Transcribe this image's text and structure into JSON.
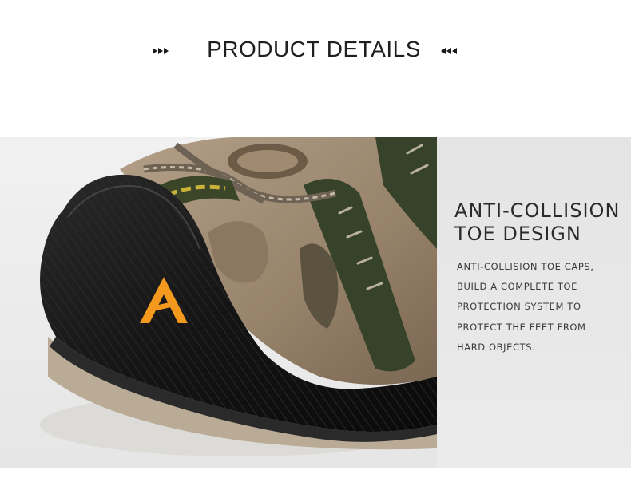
{
  "header": {
    "title": "PRODUCT DETAILS",
    "left_ornament": "triple-right-arrow-icon",
    "right_ornament": "triple-left-arrow-icon"
  },
  "feature": {
    "heading_lines": [
      "ANTI-COLLISION",
      "TOE DESIGN"
    ],
    "body_lines": [
      "ANTI-COLLISION TOE CAPS,",
      "BUILD A COMPLETE TOE",
      "PROTECTION SYSTEM TO",
      "PROTECT THE FEET FROM",
      "HARD OBJECTS."
    ]
  },
  "colors": {
    "toe_cap": "#151515",
    "leather": "#9a8670",
    "strap": "#37422a",
    "accent_logo": "#f39a1e"
  }
}
